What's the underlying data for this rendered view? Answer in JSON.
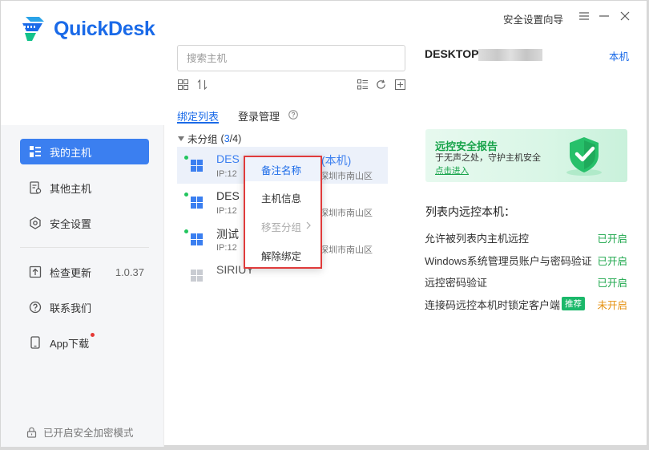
{
  "app": {
    "name": "QuickDesk",
    "brand_color": "#1a6ae8"
  },
  "titlebar": {
    "guide_label": "安全设置向导",
    "menu_icon": "menu-icon",
    "minimize_icon": "minimize-icon",
    "close_icon": "close-icon"
  },
  "sidebar": {
    "items": [
      {
        "label": "我的主机",
        "icon": "my-hosts-icon",
        "active": true
      },
      {
        "label": "其他主机",
        "icon": "other-hosts-icon"
      },
      {
        "label": "安全设置",
        "icon": "security-settings-icon"
      },
      {
        "label": "检查更新",
        "icon": "update-icon",
        "version": "1.0.37"
      },
      {
        "label": "联系我们",
        "icon": "help-icon"
      },
      {
        "label": "App下载",
        "icon": "phone-icon",
        "badge": "red-dot"
      }
    ],
    "footer": {
      "label": "已开启安全加密模式",
      "icon": "lock-icon"
    }
  },
  "host_panel": {
    "search_placeholder": "搜索主机",
    "tabs": [
      {
        "label": "绑定列表",
        "active": true
      },
      {
        "label": "登录管理"
      }
    ],
    "group": {
      "label": "未分组",
      "count_open": "(",
      "count_online": "3",
      "count_total": "/4",
      "count_close": ")"
    },
    "hosts": [
      {
        "name": "DES",
        "suffix": "(本机)",
        "ip": "IP:12",
        "location": "深圳市南山区",
        "online": true,
        "highlight": true
      },
      {
        "name": "DES",
        "ip": "IP:12",
        "location": "深圳市南山区",
        "online": true
      },
      {
        "name": "测试",
        "ip": "IP:12",
        "location": "深圳市南山区",
        "online": true
      },
      {
        "name": "SIRIUY",
        "online": false
      }
    ]
  },
  "context_menu": {
    "items": [
      {
        "label": "备注名称",
        "state": "hover"
      },
      {
        "label": "主机信息"
      },
      {
        "label": "移至分组",
        "state": "disabled",
        "submenu": true
      },
      {
        "label": "解除绑定"
      }
    ]
  },
  "info_panel": {
    "device_name": "DESKTOP",
    "this_label": "本机",
    "banner": {
      "title": "远控安全报告",
      "subtitle": "于无声之处，守护主机安全",
      "link": "点击进入"
    },
    "list_title": "列表内远控本机：",
    "settings": [
      {
        "label": "允许被列表内主机远控",
        "status": "已开启",
        "on": true
      },
      {
        "label": "Windows系统管理员账户与密码验证",
        "status": "已开启",
        "on": true
      },
      {
        "label": "远控密码验证",
        "status": "已开启",
        "on": true
      },
      {
        "label": "连接码远控本机时锁定客户端",
        "badge": "推荐",
        "status": "未开启",
        "on": false
      }
    ]
  },
  "colors": {
    "accent": "#3b7ff0",
    "on": "#1ba64a",
    "off": "#e58f0c",
    "highlight_box": "#e03b3b"
  }
}
